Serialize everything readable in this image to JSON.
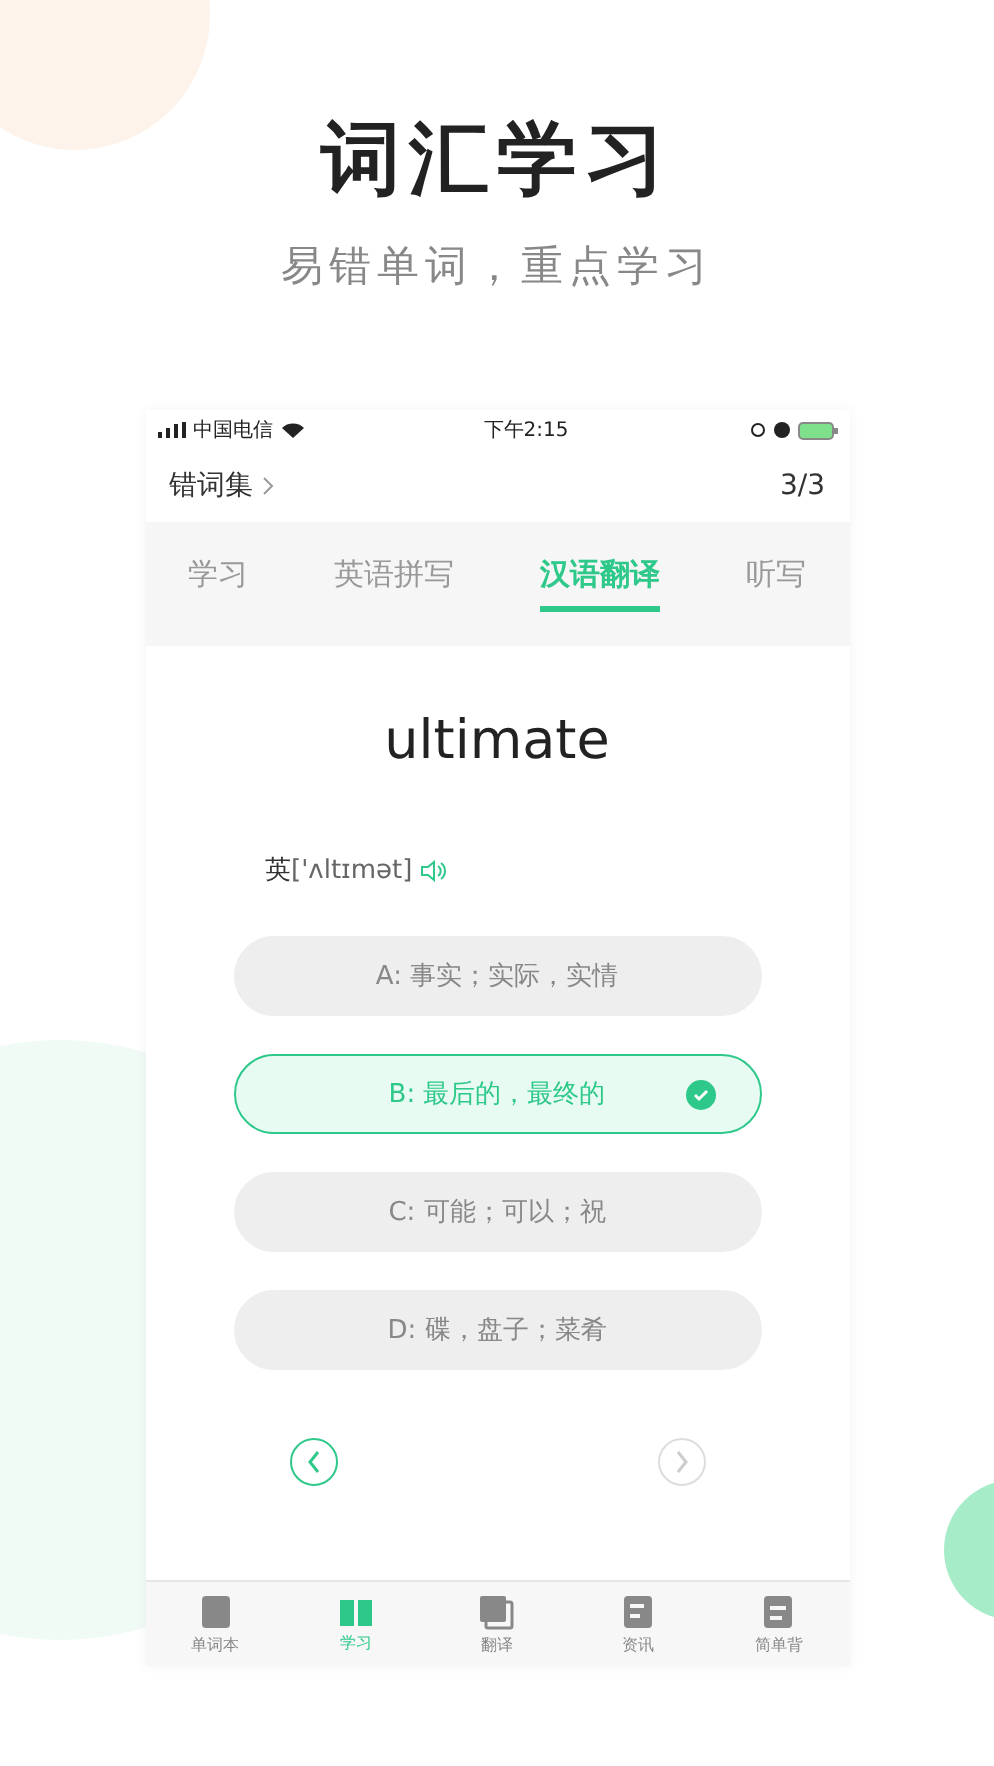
{
  "headline": {
    "title": "词汇学习",
    "subtitle": "易错单词，重点学习"
  },
  "status_bar": {
    "carrier": "中国电信",
    "time": "下午2:15"
  },
  "header": {
    "title": "错词集",
    "progress": "3/3"
  },
  "tabs": [
    {
      "label": "学习",
      "selected": false
    },
    {
      "label": "英语拼写",
      "selected": false
    },
    {
      "label": "汉语翻译",
      "selected": true
    },
    {
      "label": "听写",
      "selected": false
    }
  ],
  "word": "ultimate",
  "phonetic": {
    "region": "英",
    "ipa": "['ʌltɪmət]"
  },
  "options": [
    {
      "text": "A: 事实；实际，实情",
      "selected": false
    },
    {
      "text": "B: 最后的，最终的",
      "selected": true
    },
    {
      "text": "C: 可能；可以；祝",
      "selected": false
    },
    {
      "text": "D: 碟，盘子；菜肴",
      "selected": false
    }
  ],
  "nav": {
    "prev": {
      "disabled": false
    },
    "next": {
      "disabled": true
    }
  },
  "tab_bar": [
    {
      "label": "单词本",
      "selected": false
    },
    {
      "label": "学习",
      "selected": true
    },
    {
      "label": "翻译",
      "selected": false
    },
    {
      "label": "资讯",
      "selected": false
    },
    {
      "label": "简单背",
      "selected": false
    }
  ]
}
